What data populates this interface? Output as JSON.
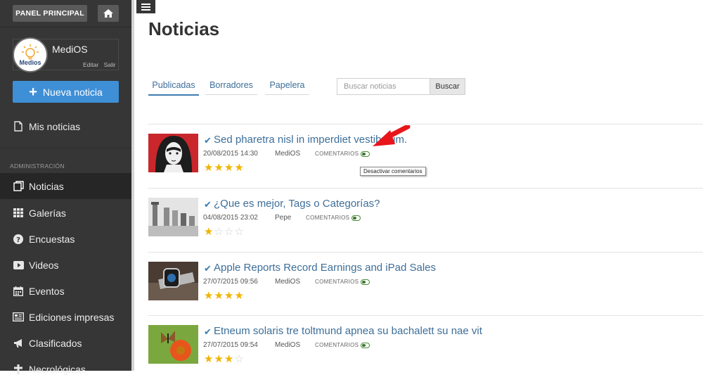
{
  "sidebar": {
    "panel_label": "PANEL PRINCIPAL",
    "home_icon": "home-icon",
    "user": {
      "name": "MediOS",
      "avatar_text": "Medios",
      "edit": "Editar",
      "logout": "Salir"
    },
    "new_button": {
      "label": "Nueva noticia",
      "color": "#3f8fd6"
    },
    "mis_noticias": "Mis noticias",
    "section_label": "ADMINISTRACIÓN",
    "items": [
      {
        "label": "Noticias",
        "icon": "news-icon",
        "active": true
      },
      {
        "label": "Galerías",
        "icon": "grid-icon"
      },
      {
        "label": "Encuestas",
        "icon": "question-icon"
      },
      {
        "label": "Videos",
        "icon": "video-icon"
      },
      {
        "label": "Eventos",
        "icon": "calendar-icon"
      },
      {
        "label": "Ediciones impresas",
        "icon": "newspaper-icon"
      },
      {
        "label": "Clasificados",
        "icon": "megaphone-icon"
      },
      {
        "label": "Necrológicas",
        "icon": "cross-icon"
      }
    ]
  },
  "main": {
    "title": "Noticias",
    "tabs": [
      {
        "label": "Publicadas",
        "active": true
      },
      {
        "label": "Borradores"
      },
      {
        "label": "Papelera"
      }
    ],
    "search": {
      "placeholder": "Buscar noticias",
      "button": "Buscar"
    },
    "tooltip": "Desactivar comentarios",
    "comments_label": "COMENTARIOS",
    "news": [
      {
        "title": "Sed pharetra nisl in imperdiet vestibulum.",
        "date": "20/08/2015 14:30",
        "author": "MediOS",
        "rating": 4,
        "max": 4
      },
      {
        "title": "¿Que es mejor, Tags o Categorías?",
        "date": "04/08/2015 23:02",
        "author": "Pepe",
        "rating": 1,
        "max": 5
      },
      {
        "title": "Apple Reports Record Earnings and iPad Sales",
        "date": "27/07/2015 09:56",
        "author": "MediOS",
        "rating": 4,
        "max": 4
      },
      {
        "title": "Etneum solaris tre toltmund apnea su bachalett su nae vit",
        "date": "27/07/2015 09:54",
        "author": "MediOS",
        "rating": 3,
        "max": 4
      }
    ]
  }
}
